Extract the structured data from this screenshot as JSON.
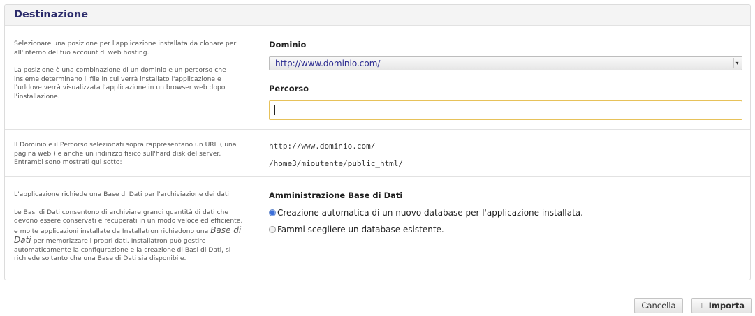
{
  "panel": {
    "title": "Destinazione"
  },
  "location": {
    "desc_p1": "Selezionare una posizione per l'applicazione installata da clonare per all'interno del tuo account di web hosting.",
    "desc_p2": "La posizione è una combinazione di un dominio e un percorso che insieme determinano il file in cui verrà installato l'applicazione e l'urldove verrà visualizzata l'applicazione in un browser web dopo l'installazione.",
    "domain_label": "Dominio",
    "domain_value": "http://www.dominio.com/",
    "path_label": "Percorso",
    "path_value": ""
  },
  "url_info": {
    "desc": "Il Dominio e il Percorso selezionati sopra rappresentano un URL ( una pagina web ) e anche un indirizzo fisico sull'hard disk del server. Entrambi sono mostrati qui sotto:",
    "url": "http://www.dominio.com/",
    "filesystem_path": "/home3/mioutente/public_html/"
  },
  "database": {
    "desc_p1": "L'applicazione richiede una Base di Dati per l'archiviazione dei dati",
    "desc_p2_a": "Le Basi di Dati consentono di archiviare grandi quantità di dati che devono essere conservati e recuperati in un modo veloce ed efficiente, e molte applicazioni installate da Installatron richiedono una",
    "desc_p2_em": "Base di Dati",
    "desc_p2_b": "per memorizzare i propri dati. Installatron può gestire automaticamente la configurazione e la creazione di Basi di Dati, si richiede soltanto che una Base di Dati sia disponibile.",
    "admin_label": "Amministrazione Base di Dati",
    "option_auto": "Creazione automatica di un nuovo database per l'applicazione installata.",
    "option_existing": "Fammi scegliere un database esistente.",
    "selected": "auto"
  },
  "footer": {
    "cancel_label": "Cancella",
    "import_label": "Importa"
  },
  "colors": {
    "title": "#2b2b6b",
    "input_focus_border": "#e7c25a",
    "link": "#2a2a90"
  }
}
